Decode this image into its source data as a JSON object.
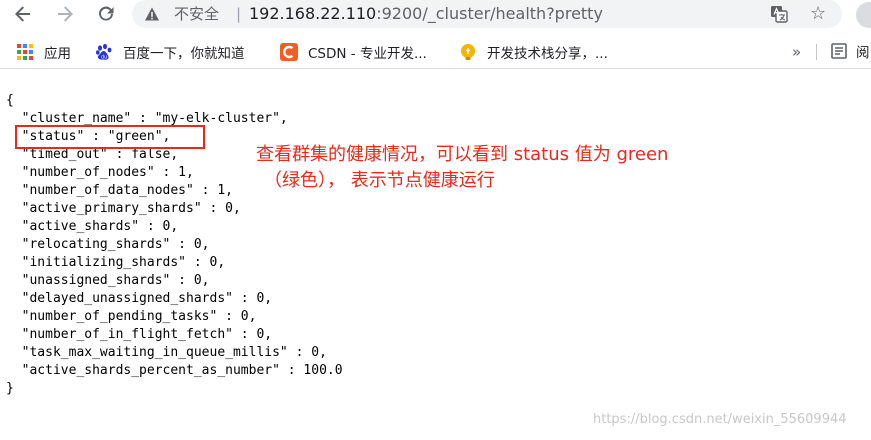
{
  "browser": {
    "security_label": "不安全",
    "separator": "|",
    "url_host": "192.168.22.110",
    "url_rest": ":9200/_cluster/health?pretty",
    "star_glyph": "☆"
  },
  "bookmarks": {
    "items": [
      {
        "label": "应用",
        "icon": "apps-grid-icon"
      },
      {
        "label": "百度一下，你就知道",
        "icon": "baidu-paw-icon"
      },
      {
        "label": "CSDN - 专业开发...",
        "icon": "csdn-logo-icon"
      },
      {
        "label": "开发技术栈分享，...",
        "icon": "lightbulb-icon"
      }
    ],
    "more_glyph": "»",
    "reading_list_label": "阅"
  },
  "json_lines": [
    "{",
    "  \"cluster_name\" : \"my-elk-cluster\",",
    "  \"status\" : \"green\",",
    "  \"timed_out\" : false,",
    "  \"number_of_nodes\" : 1,",
    "  \"number_of_data_nodes\" : 1,",
    "  \"active_primary_shards\" : 0,",
    "  \"active_shards\" : 0,",
    "  \"relocating_shards\" : 0,",
    "  \"initializing_shards\" : 0,",
    "  \"unassigned_shards\" : 0,",
    "  \"delayed_unassigned_shards\" : 0,",
    "  \"number_of_pending_tasks\" : 0,",
    "  \"number_of_in_flight_fetch\" : 0,",
    "  \"task_max_waiting_in_queue_millis\" : 0,",
    "  \"active_shards_percent_as_number\" : 100.0",
    "}"
  ],
  "annotation": {
    "line1": "查看群集的健康情况，可以看到 status 值为 green",
    "line2": "（绿色）， 表示节点健康运行",
    "color": "#e8291c"
  },
  "watermark": "https://blog.csdn.net/weixin_55609944"
}
